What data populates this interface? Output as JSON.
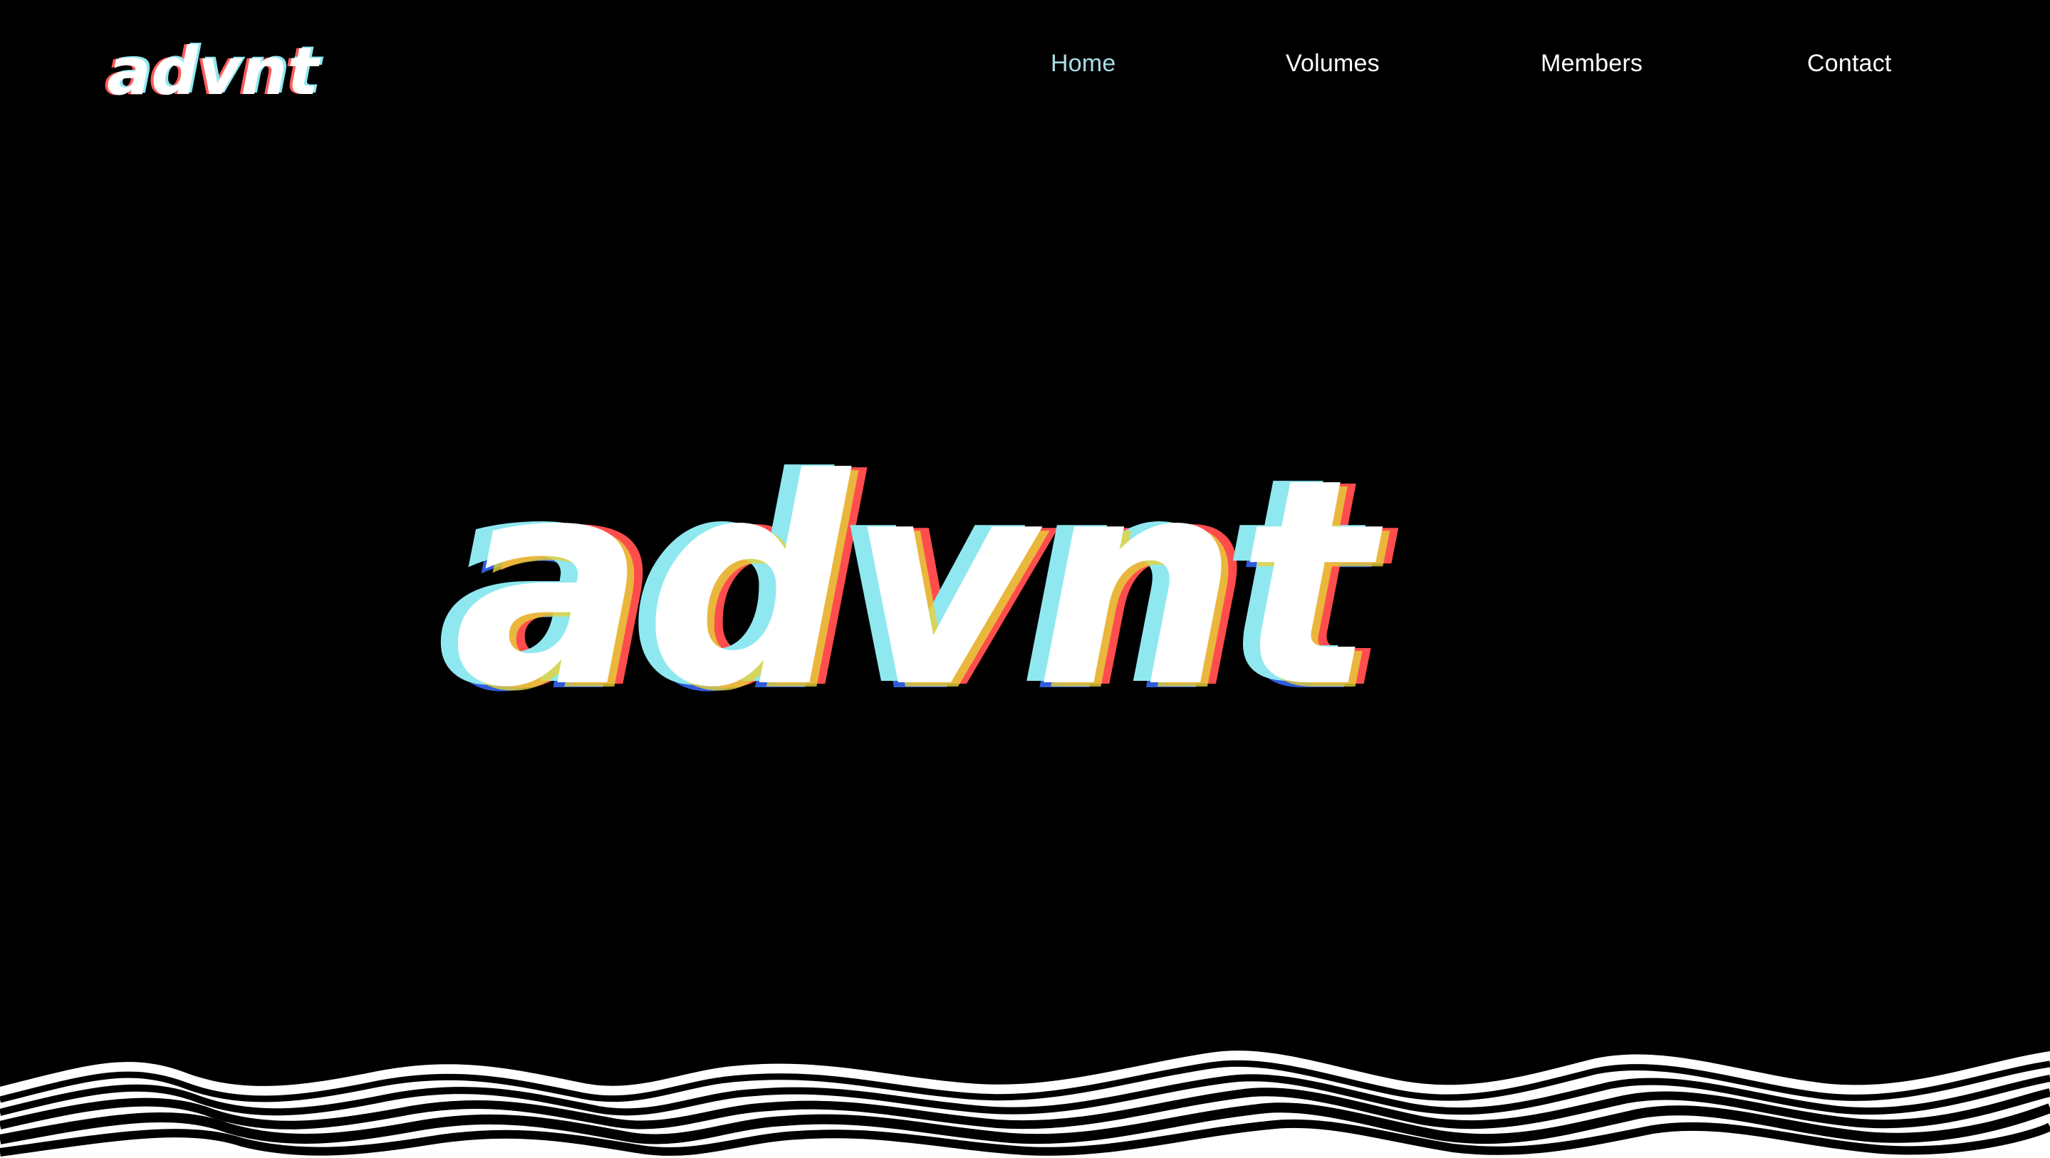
{
  "brand": {
    "name": "advnt",
    "logo_text": "advnt",
    "logo_icon": "advnt-glitch-logo",
    "colors": {
      "background": "#000000",
      "text": "#ffffff",
      "nav_active": "#a8dde6",
      "glitch_red": "#ff4d4d",
      "glitch_cyan": "#8fe8f0",
      "glitch_yellow": "#e6d23a",
      "glitch_blue": "#3a6bff"
    }
  },
  "nav": {
    "items": [
      {
        "label": "Home",
        "active": true
      },
      {
        "label": "Volumes",
        "active": false
      },
      {
        "label": "Members",
        "active": false
      },
      {
        "label": "Contact",
        "active": false
      }
    ]
  },
  "hero": {
    "title": "advnt"
  }
}
